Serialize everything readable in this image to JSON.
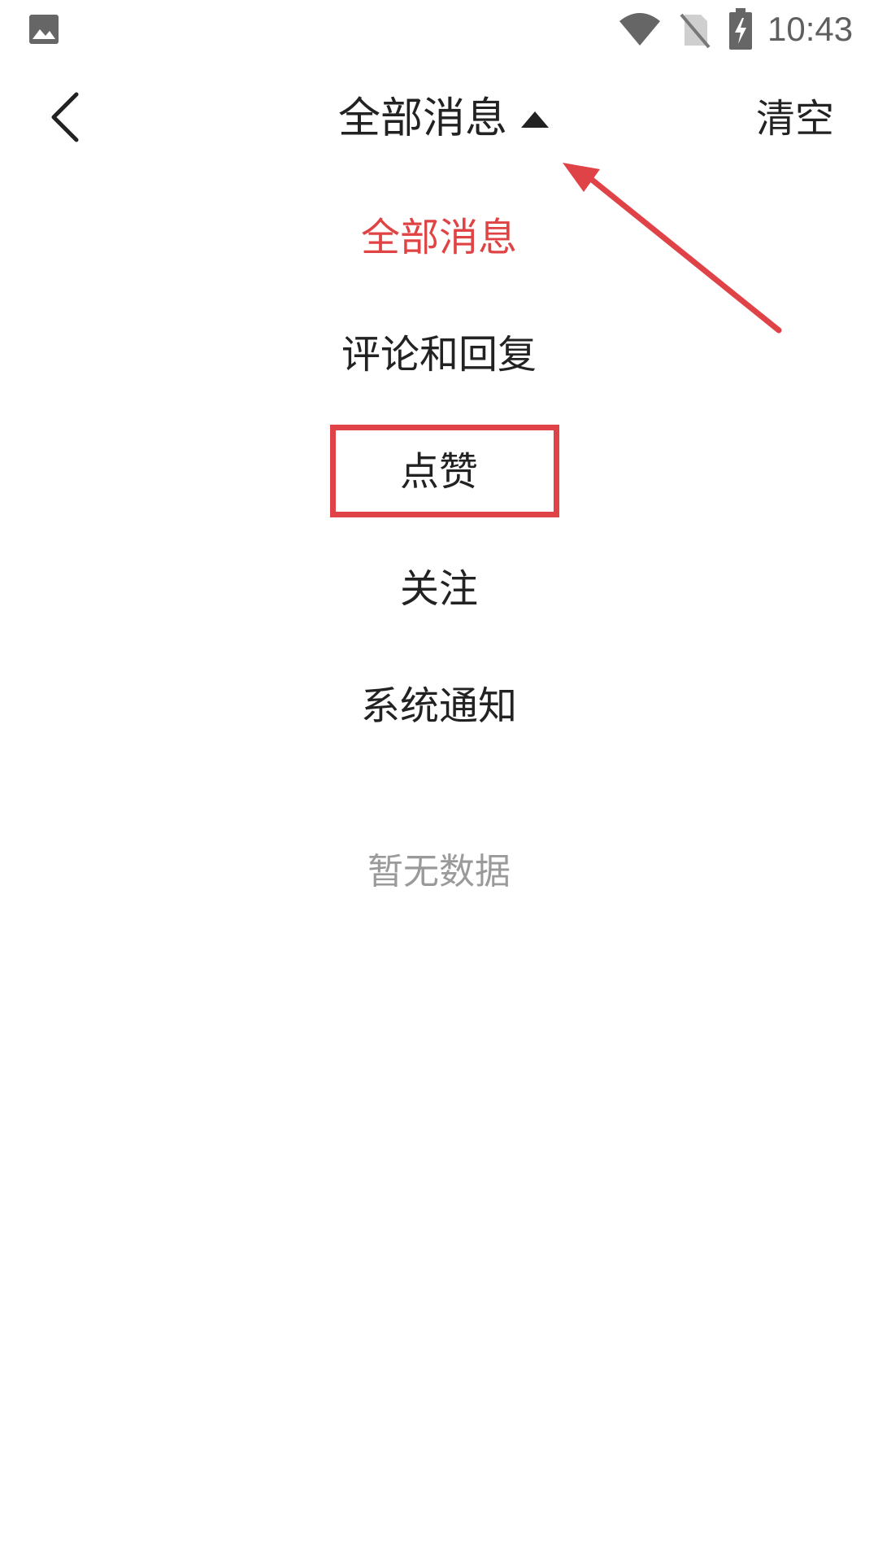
{
  "status_bar": {
    "time": "10:43",
    "icons": [
      "gallery-icon",
      "wifi-icon",
      "no-sim-icon",
      "battery-charging-icon"
    ]
  },
  "header": {
    "back_icon": "chevron-left-icon",
    "title": "全部消息",
    "title_indicator_icon": "caret-up-icon",
    "clear_label": "清空"
  },
  "filter_menu": {
    "items": [
      {
        "label": "全部消息",
        "selected": true
      },
      {
        "label": "评论和回复",
        "selected": false
      },
      {
        "label": "点赞",
        "selected": false
      },
      {
        "label": "关注",
        "selected": false
      },
      {
        "label": "系统通知",
        "selected": false
      }
    ]
  },
  "empty_state": {
    "message": "暂无数据"
  },
  "colors": {
    "accent_red": "#e04343",
    "text_primary": "#222222",
    "text_muted": "#9a9a9a",
    "annotation_red": "#e04347"
  }
}
